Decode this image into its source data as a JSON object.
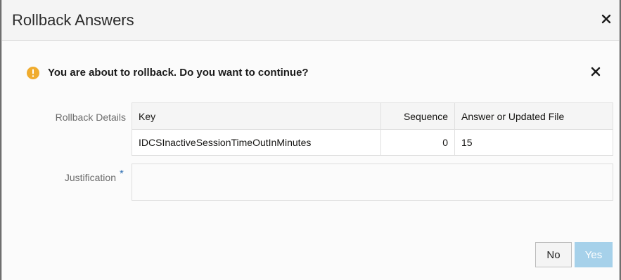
{
  "dialog": {
    "title": "Rollback Answers",
    "message": "You are about to rollback. Do you want to continue?",
    "details_label": "Rollback Details",
    "justification_label": "Justification",
    "required_marker": "*",
    "table": {
      "headers": [
        "Key",
        "Sequence",
        "Answer or Updated File"
      ],
      "rows": [
        [
          "IDCSInactiveSessionTimeOutInMinutes",
          "0",
          "15"
        ]
      ]
    },
    "justification_value": "",
    "buttons": {
      "no": "No",
      "yes": "Yes"
    }
  },
  "colors": {
    "warning": "#f0ac2e",
    "required": "#2f6fb3",
    "yes_button_disabled": "#a6d1ea"
  }
}
